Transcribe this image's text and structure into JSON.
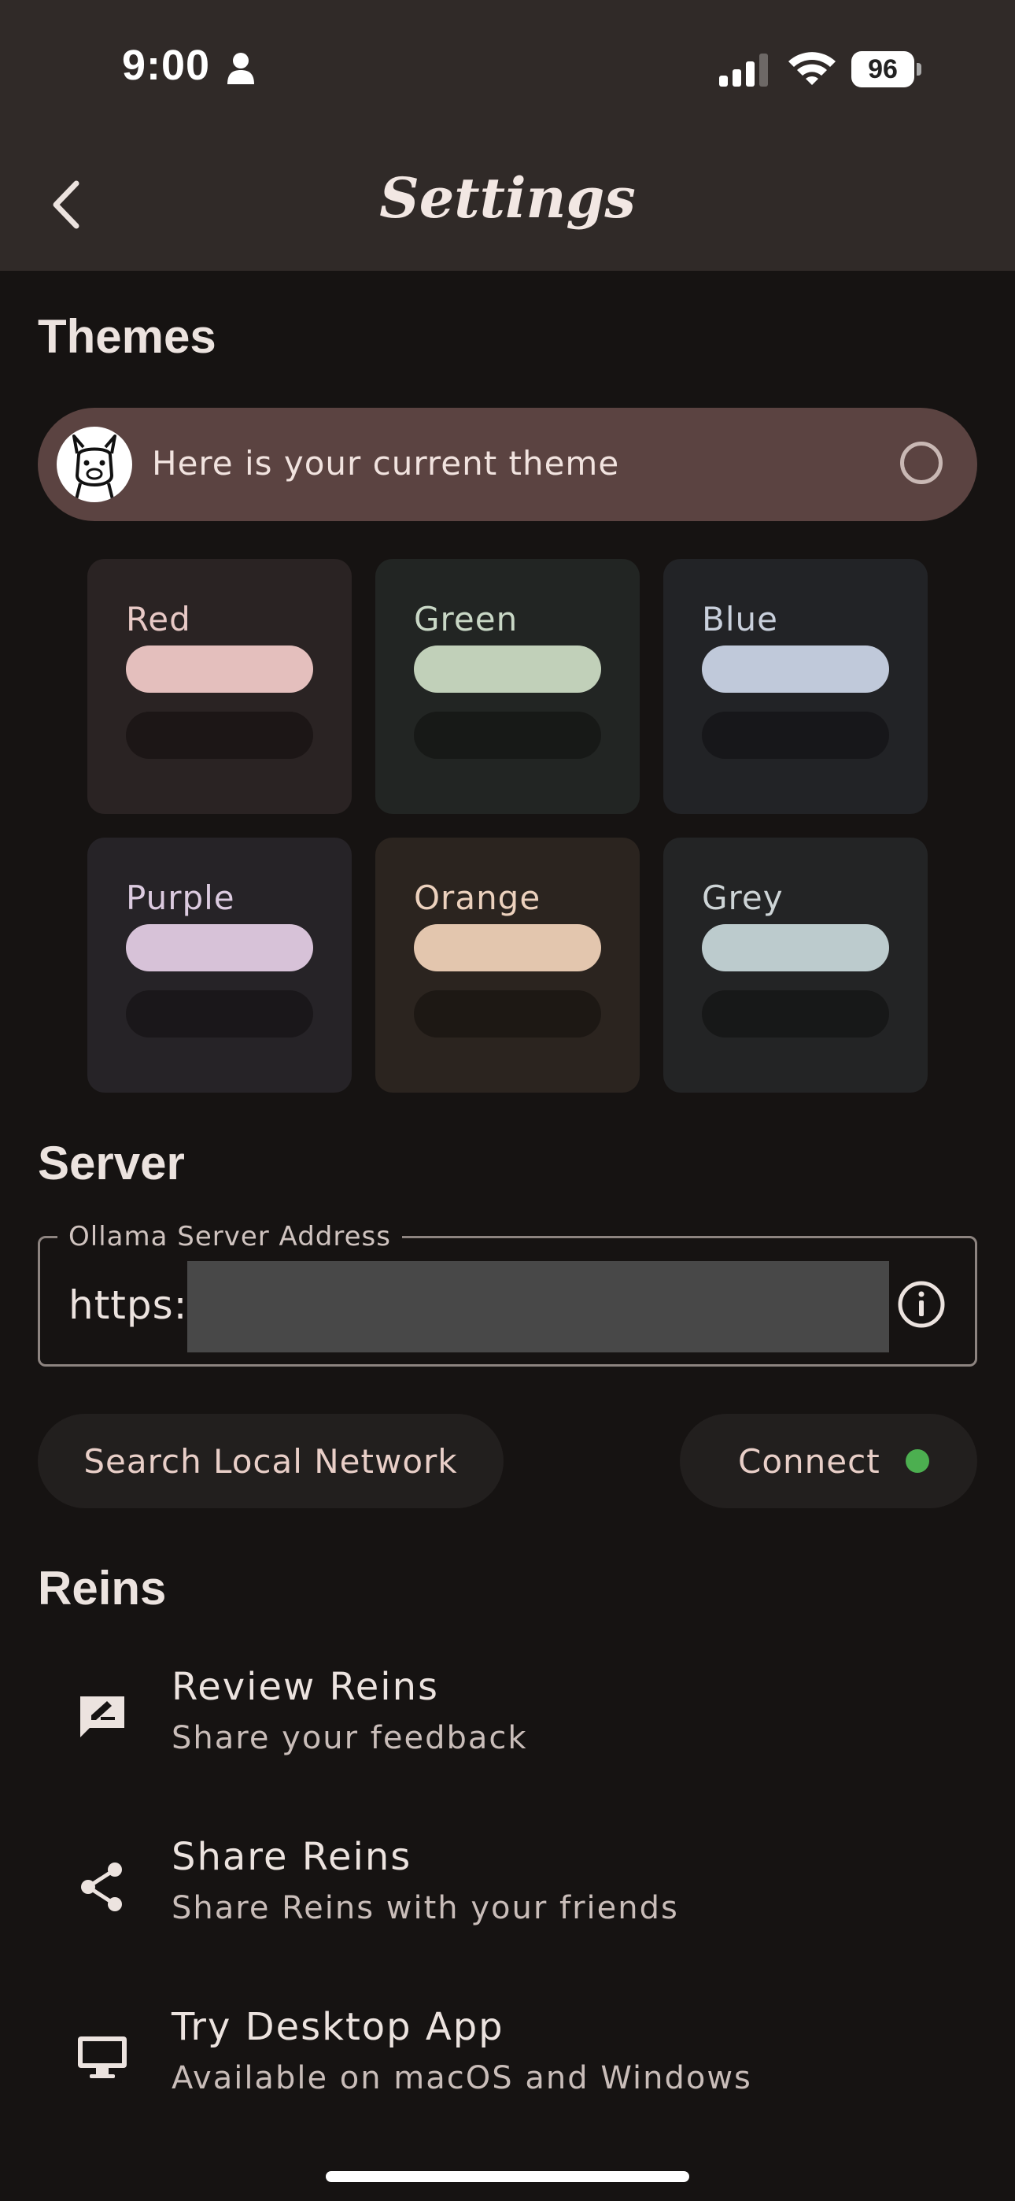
{
  "status_bar": {
    "time": "9:00",
    "battery": "96",
    "icons": [
      "person-icon",
      "cellular-signal-icon",
      "wifi-icon",
      "battery-icon"
    ]
  },
  "header": {
    "title": "Settings",
    "back_icon": "chevron-left-icon"
  },
  "themes": {
    "section_title": "Themes",
    "current_theme_label": "Here is your current theme",
    "options": [
      {
        "name": "Red",
        "card_color": "#2a2323",
        "text_color": "#e8c9c6",
        "primary": "#e4bfbd",
        "secondary": "#1c1616"
      },
      {
        "name": "Green",
        "card_color": "#222523",
        "text_color": "#c9d8c6",
        "primary": "#c1d0b9",
        "secondary": "#171917"
      },
      {
        "name": "Blue",
        "card_color": "#222326",
        "text_color": "#c9d0dc",
        "primary": "#c0c9da",
        "secondary": "#17171a"
      },
      {
        "name": "Purple",
        "card_color": "#262327",
        "text_color": "#dccbe0",
        "primary": "#d7c2d8",
        "secondary": "#1a171a"
      },
      {
        "name": "Orange",
        "card_color": "#2b241f",
        "text_color": "#ecd1bd",
        "primary": "#e3c6ae",
        "secondary": "#1d1814"
      },
      {
        "name": "Grey",
        "card_color": "#232425",
        "text_color": "#cdd4d6",
        "primary": "#bccbcd",
        "secondary": "#171818"
      }
    ]
  },
  "server": {
    "section_title": "Server",
    "field_label": "Ollama Server Address",
    "field_value": "https:/",
    "search_button": "Search Local Network",
    "connect_button": "Connect",
    "connect_status_color": "#4caf50"
  },
  "reins": {
    "section_title": "Reins",
    "items": [
      {
        "title": "Review Reins",
        "subtitle": "Share your feedback",
        "icon": "rate-review-icon"
      },
      {
        "title": "Share Reins",
        "subtitle": "Share Reins with your friends",
        "icon": "share-icon"
      },
      {
        "title": "Try Desktop App",
        "subtitle": "Available on macOS and Windows",
        "icon": "desktop-monitor-icon"
      }
    ]
  },
  "colors": {
    "background": "#161312",
    "header": "#302a28",
    "current_theme_bar": "#5b4341",
    "button_bg": "#221f1e",
    "accent_text": "#e9cfc8"
  }
}
